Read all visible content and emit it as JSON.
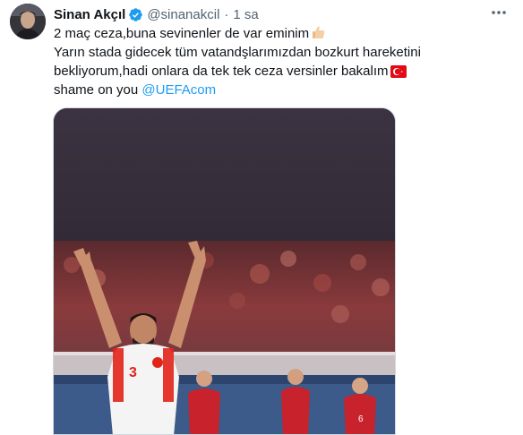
{
  "tweet": {
    "author_name": "Sinan Akçıl",
    "handle": "@sinanakcil",
    "separator": "·",
    "time": "1 sa",
    "lines": [
      "2 maç ceza,buna sevinenler de var eminim",
      " Yarın stada gidecek tüm vatandşlarımızdan bozkurt hareketini",
      "bekliyorum,hadi onlara da tek tek ceza versinler bakalım",
      "shame on you "
    ],
    "mention": "@UEFAcom",
    "jersey_number": "3"
  },
  "icons": {
    "verified": "verified-badge-icon",
    "more": "more-options-icon",
    "thumb": "thumbs-up-emoji",
    "flag": "turkey-flag-emoji"
  },
  "colors": {
    "accent": "#1d9bf0",
    "text": "#0f1419",
    "secondary": "#536471",
    "media_top": "#3a3340",
    "jersey_white": "#f4f4f4",
    "opponent_red": "#c8232c"
  }
}
